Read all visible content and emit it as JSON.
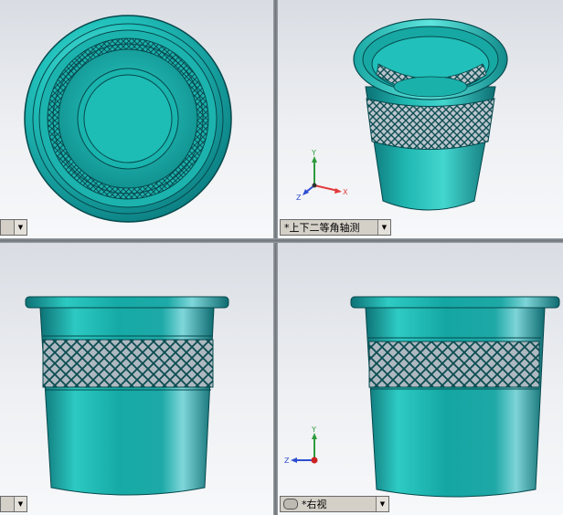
{
  "viewports": {
    "top_left": {
      "view_label": ""
    },
    "top_right": {
      "view_label": "*上下二等角轴测"
    },
    "bottom_left": {
      "view_label": ""
    },
    "bottom_right": {
      "view_label": "*右视"
    }
  },
  "triad_axes": {
    "x": "X",
    "y": "Y",
    "z": "Z"
  },
  "colors": {
    "model_teal": "#1fb7b2",
    "model_dark": "#0e6f73",
    "x_axis": "#e23b3b",
    "y_axis": "#2e9b3d",
    "z_axis": "#2f4fd0",
    "viewport_bg": "#eef0f3"
  },
  "icons": [
    "chevron-down-icon",
    "link-views-icon",
    "coordinate-triad-icon"
  ]
}
